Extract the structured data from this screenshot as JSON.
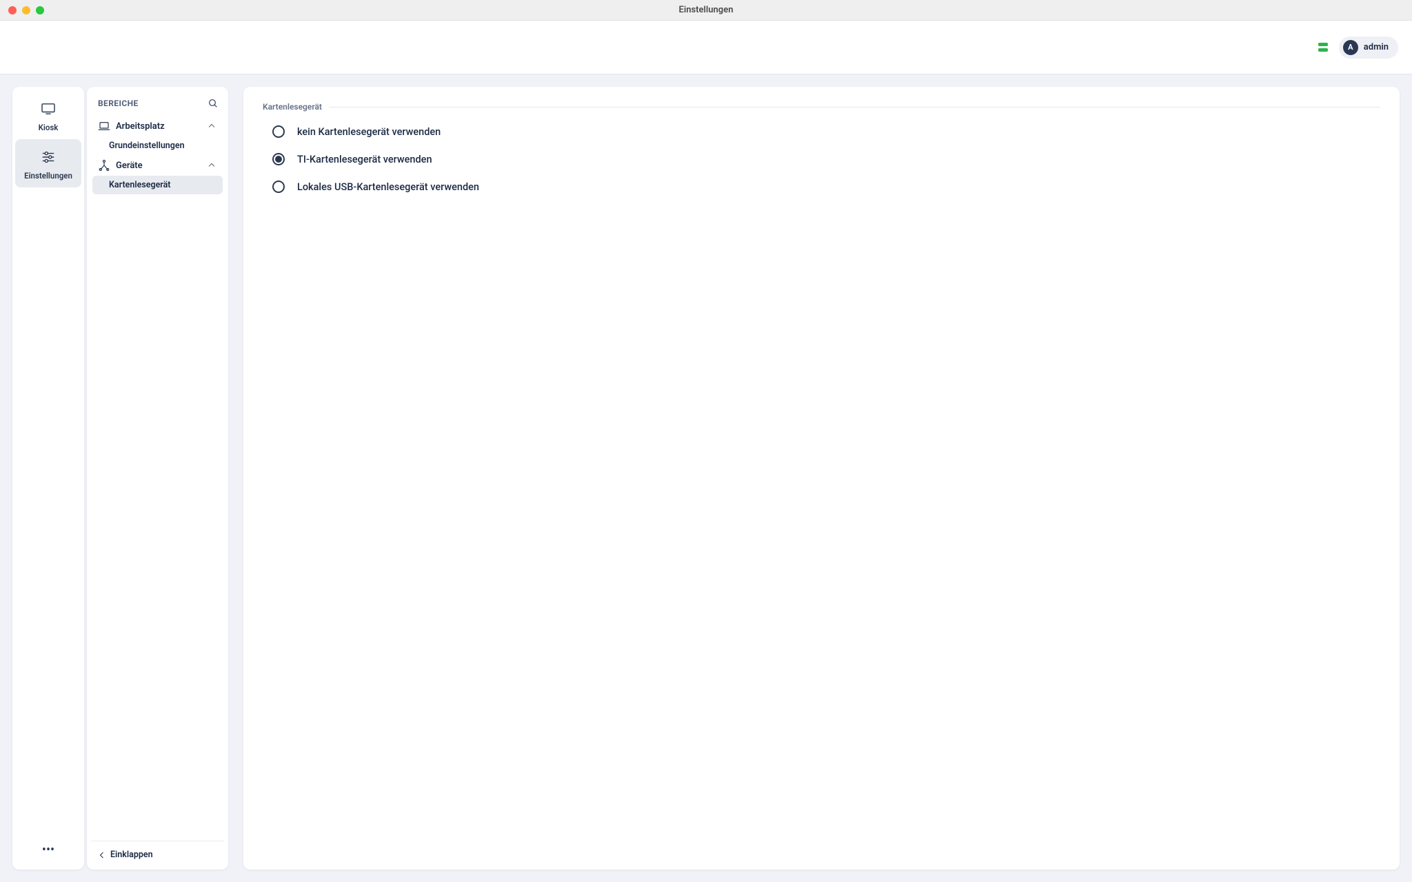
{
  "window": {
    "title": "Einstellungen"
  },
  "toolbar": {
    "user_initial": "A",
    "user_name": "admin"
  },
  "rail": {
    "items": [
      {
        "label": "Kiosk",
        "active": false
      },
      {
        "label": "Einstellungen",
        "active": true
      }
    ],
    "more_label": "•••"
  },
  "nav": {
    "heading": "BEREICHE",
    "collapse_label": "Einklappen",
    "sections": [
      {
        "label": "Arbeitsplatz",
        "expanded": true,
        "items": [
          {
            "label": "Grundeinstellungen",
            "active": false
          }
        ]
      },
      {
        "label": "Geräte",
        "expanded": true,
        "items": [
          {
            "label": "Kartenlesegerät",
            "active": true
          }
        ]
      }
    ]
  },
  "main": {
    "group_title": "Kartenlesegerät",
    "radio_options": [
      {
        "label": "kein Kartenlesegerät verwenden",
        "selected": false
      },
      {
        "label": "TI-Kartenlesegerät verwenden",
        "selected": true
      },
      {
        "label": "Lokales USB-Kartenlesegerät verwenden",
        "selected": false
      }
    ]
  }
}
